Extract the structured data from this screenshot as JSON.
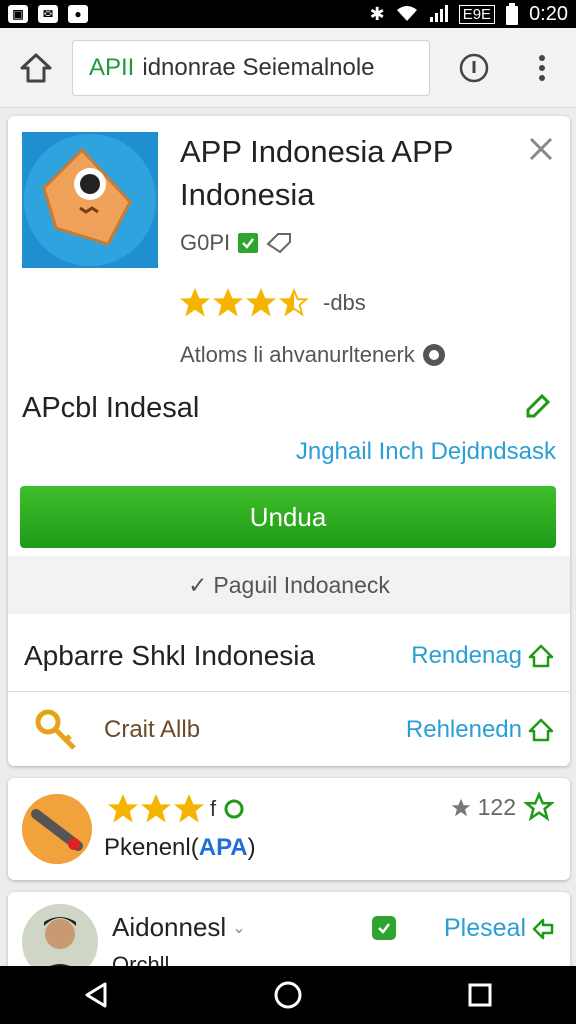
{
  "status_bar": {
    "clock": "0:20",
    "carrier_badge": "E9E"
  },
  "browser": {
    "url_scheme": "APII",
    "url_text": "idnonrae Seiemalnole"
  },
  "app": {
    "title": "APP Indonesia APP Indonesia",
    "developer": "G0PI",
    "rating_stars": 3.5,
    "rating_count": "-dbs",
    "ads_note": "Atloms li ahvanurltenerk",
    "section_title": "APcbl Indesal",
    "link": "Jnghail Inch Dejdndsask",
    "install_label": "Undua",
    "sub_label": "Paguil Indoaneck"
  },
  "rows": [
    {
      "title": "Apbarre Shkl Indonesia",
      "link": "Rendenag"
    },
    {
      "title": "Crait Allb",
      "link": "Rehlenedn"
    }
  ],
  "review": {
    "stars": 3,
    "stars_suffix": "f",
    "name": "Pkenenl(",
    "name_tag": "APA",
    "name_close": ")",
    "score": "122"
  },
  "user": {
    "name": "Aidonnesl",
    "sub": "Orchll",
    "link": "Pleseal"
  },
  "colors": {
    "green": "#1f9a17",
    "link_blue": "#2a9fd6",
    "star": "#f5b400"
  }
}
